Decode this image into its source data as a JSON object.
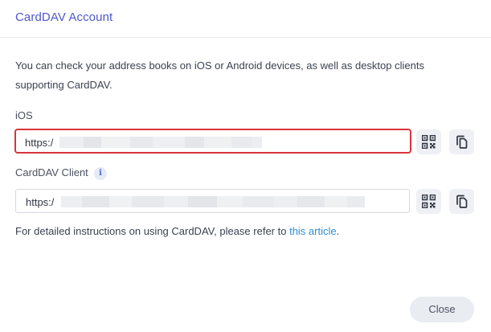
{
  "dialog": {
    "title": "CardDAV Account",
    "description": "You can check your address books on iOS or Android devices, as well as desktop clients supporting CardDAV.",
    "ios": {
      "label": "iOS",
      "url_visible": "https:/"
    },
    "client": {
      "label": "CardDAV Client",
      "info_glyph": "i",
      "url_visible": "https:/"
    },
    "footnote": {
      "text": "For detailed instructions on using CardDAV, please refer to ",
      "link_text": "this article",
      "suffix": "."
    },
    "close_label": "Close",
    "colors": {
      "title": "#4e57c9",
      "highlight_border": "#d9343b",
      "link": "#2d8fd6"
    },
    "icons": [
      "qr-code-icon",
      "copy-icon",
      "info-icon"
    ]
  }
}
